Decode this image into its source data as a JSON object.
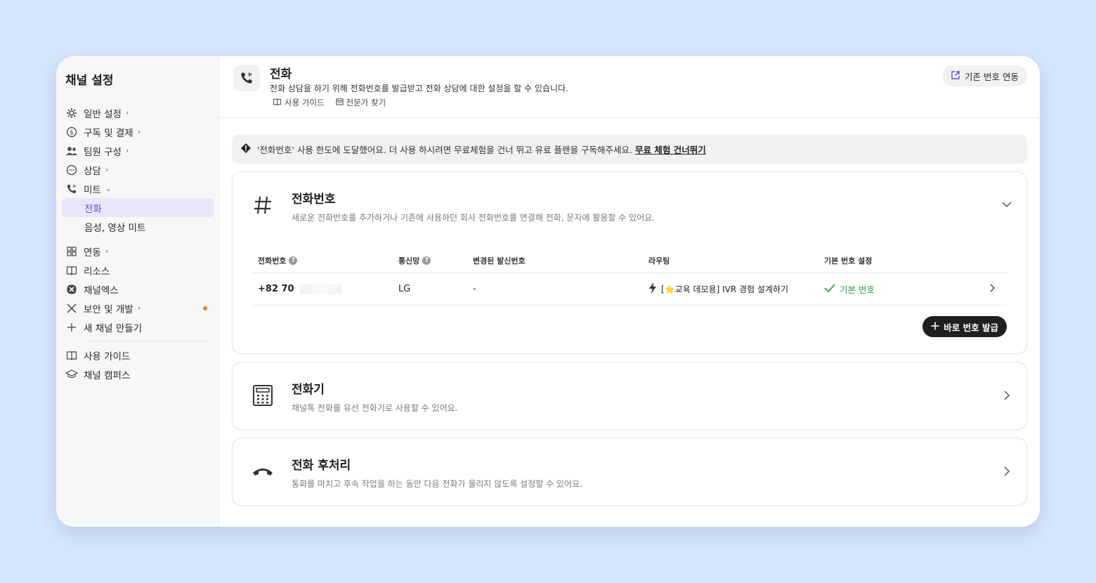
{
  "sidebar": {
    "title": "채널 설정",
    "items": [
      {
        "label": "일반 설정",
        "icon": "gear-icon"
      },
      {
        "label": "구독 및 결제",
        "icon": "dollar-icon"
      },
      {
        "label": "팀원 구성",
        "icon": "people-icon"
      },
      {
        "label": "상담",
        "icon": "chat-icon"
      },
      {
        "label": "미트",
        "icon": "phone-icon"
      }
    ],
    "sub_items": [
      {
        "label": "전화",
        "active": true
      },
      {
        "label": "음성, 영상 미트",
        "active": false
      }
    ],
    "items2": [
      {
        "label": "연동",
        "icon": "grid-icon"
      },
      {
        "label": "리소스",
        "icon": "book-icon"
      },
      {
        "label": "채널엑스",
        "icon": "channelx-icon"
      },
      {
        "label": "보안 및 개발",
        "icon": "tools-icon"
      },
      {
        "label": "새 채널 만들기",
        "icon": "plus-icon"
      }
    ],
    "items3": [
      {
        "label": "사용 가이드",
        "icon": "book-icon"
      },
      {
        "label": "채널 캠퍼스",
        "icon": "graduation-icon"
      }
    ],
    "accent": "#5b4fd9",
    "dot_color": "#f07b2b"
  },
  "header": {
    "title": "전화",
    "description": "전화 상담을 하기 위해 전화번호를 발급받고 전화 상담에 대한 설정을 할 수 있습니다.",
    "link_guide": "사용 가이드",
    "link_expert": "전문가 찾기",
    "connect_button": "기존 번호 연동"
  },
  "alert": {
    "message": "'전화번호' 사용 한도에 도달했어요. 더 사용 하시려면 무료체험을 건너 뛰고 유료 플랜을 구독해주세요.",
    "link": "무료 체험 건너뛰기"
  },
  "phone_card": {
    "title": "전화번호",
    "description": "새로운 전화번호를 추가하거나 기존에 사용하던 회사 전화번호를 연결해 전화, 문자에 활용할 수 있어요.",
    "columns": [
      "전화번호",
      "통신망",
      "변경된 발신번호",
      "라우팅",
      "기본 번호 설정"
    ],
    "rows": [
      {
        "number": "+82 70",
        "carrier": "LG",
        "caller_id": "-",
        "routing": "[⭐교육 데모용] IVR 경험 설계하기",
        "default": "기본 번호"
      }
    ],
    "issue_button": "바로 번호 발급"
  },
  "desk_card": {
    "title": "전화기",
    "description": "채널톡 전화를 유선 전화기로 사용할 수 있어요."
  },
  "after_card": {
    "title": "전화 후처리",
    "description": "통화를 마치고 후속 작업을 하는 동안 다음 전화가 울리지 않도록 설정할 수 있어요."
  }
}
